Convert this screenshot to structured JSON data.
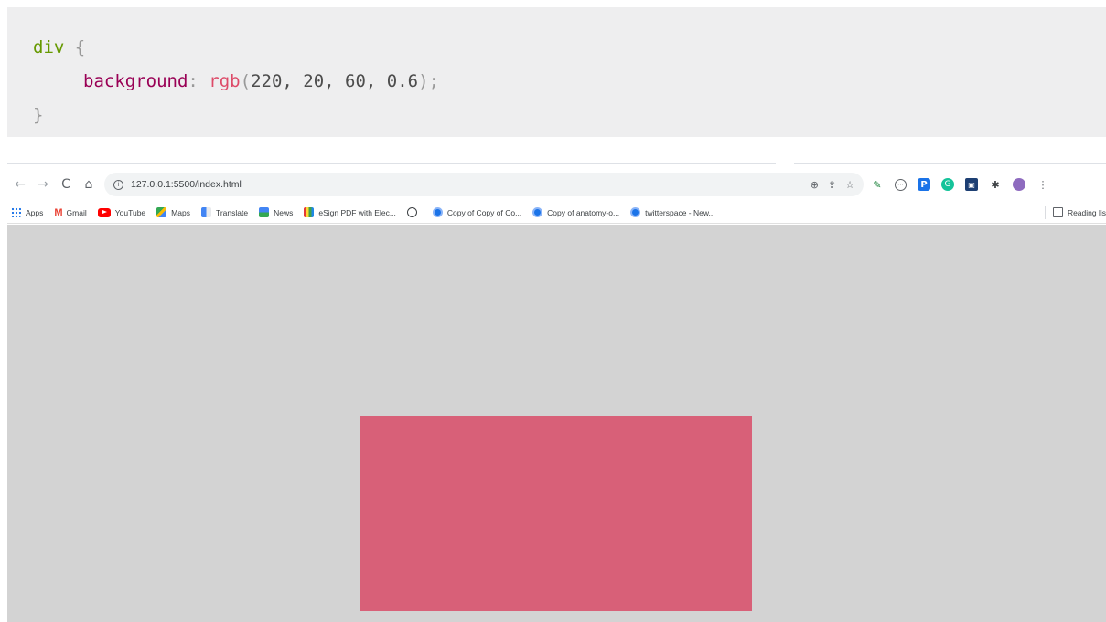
{
  "code": {
    "selector": "div",
    "open_brace": "{",
    "property": "background",
    "colon": ":",
    "function": "rgb",
    "open_paren": "(",
    "args": "220, 20, 60, 0.6",
    "close_paren": ")",
    "semicolon": ";",
    "close_brace": "}"
  },
  "browser": {
    "nav": {
      "back": "←",
      "forward": "→",
      "reload": "C",
      "home": "⌂"
    },
    "url": "127.0.0.1:5500/index.html",
    "info_glyph": "i",
    "omnibox_actions": [
      "⊕",
      "⇪",
      "☆"
    ],
    "extensions": [
      "✎",
      "⋯",
      "P",
      "G",
      "▣",
      "✱",
      "",
      "⋮"
    ],
    "bookmarks": [
      {
        "label": "Apps",
        "icon": "apps-grid-icon"
      },
      {
        "label": "Gmail",
        "icon": "gmail-icon"
      },
      {
        "label": "YouTube",
        "icon": "youtube-icon"
      },
      {
        "label": "Maps",
        "icon": "maps-icon"
      },
      {
        "label": "Translate",
        "icon": "translate-icon"
      },
      {
        "label": "News",
        "icon": "news-icon"
      },
      {
        "label": "eSign PDF with Elec...",
        "icon": "esign-icon"
      },
      {
        "label": "",
        "icon": "globe-icon"
      },
      {
        "label": "Copy of Copy of Co...",
        "icon": "chrome-icon"
      },
      {
        "label": "Copy of anatomy-o...",
        "icon": "chrome-icon"
      },
      {
        "label": "twitterspace - New...",
        "icon": "chrome-icon"
      }
    ],
    "reading_list": "Reading lis"
  },
  "preview": {
    "background": "#d3d3d3",
    "div_color": "rgba(220, 20, 60, 0.6)"
  }
}
